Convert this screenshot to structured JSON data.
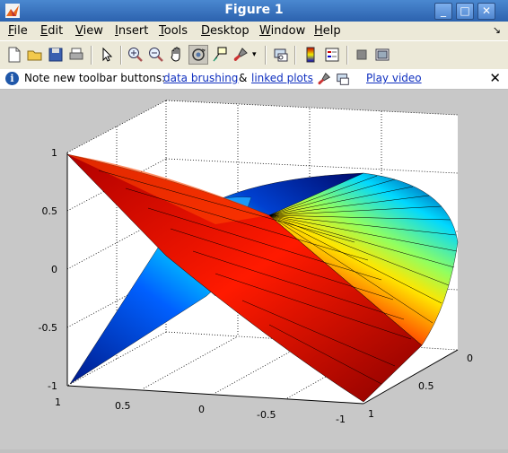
{
  "window": {
    "title": "Figure 1"
  },
  "window_controls": {
    "minimize": "_",
    "maximize": "□",
    "close": "✕"
  },
  "menu": [
    {
      "label": "File",
      "mnemonic": "F",
      "rest": "ile"
    },
    {
      "label": "Edit",
      "mnemonic": "E",
      "rest": "dit"
    },
    {
      "label": "View",
      "mnemonic": "V",
      "rest": "iew"
    },
    {
      "label": "Insert",
      "mnemonic": "I",
      "rest": "nsert"
    },
    {
      "label": "Tools",
      "mnemonic": "T",
      "rest": "ools"
    },
    {
      "label": "Desktop",
      "mnemonic": "D",
      "rest": "esktop"
    },
    {
      "label": "Window",
      "mnemonic": "W",
      "rest": "indow"
    },
    {
      "label": "Help",
      "mnemonic": "H",
      "rest": "elp"
    }
  ],
  "toolbar": {
    "buttons": [
      "new-figure-icon",
      "open-file-icon",
      "save-icon",
      "print-icon",
      "edit-plot-icon",
      "zoom-in-icon",
      "zoom-out-icon",
      "pan-icon",
      "rotate-3d-icon",
      "data-cursor-icon",
      "brush-icon",
      "link-plot-icon",
      "colorbar-icon",
      "legend-icon",
      "hide-plot-tools-icon",
      "show-plot-tools-icon"
    ],
    "active": "rotate-3d-icon",
    "dropdown_arrow": "▾"
  },
  "infobar": {
    "icon": "i",
    "message": "Note new toolbar buttons:",
    "link_brushing": "data brushing",
    "ampersand": "&",
    "link_plots": "linked plots",
    "link_video": "Play video",
    "close": "✕"
  },
  "axes": {
    "z_ticks": [
      "1",
      "0.5",
      "0",
      "-0.5",
      "-1"
    ],
    "x_ticks": [
      "1",
      "0.5",
      "0",
      "-0.5",
      "-1"
    ],
    "y_ticks": [
      "0",
      "0.5",
      "1"
    ]
  },
  "colors": {
    "face": "#d4d0c8",
    "axes_bg": "#ffffff",
    "link": "#1030c0",
    "title_bar": "#2c62ae"
  }
}
